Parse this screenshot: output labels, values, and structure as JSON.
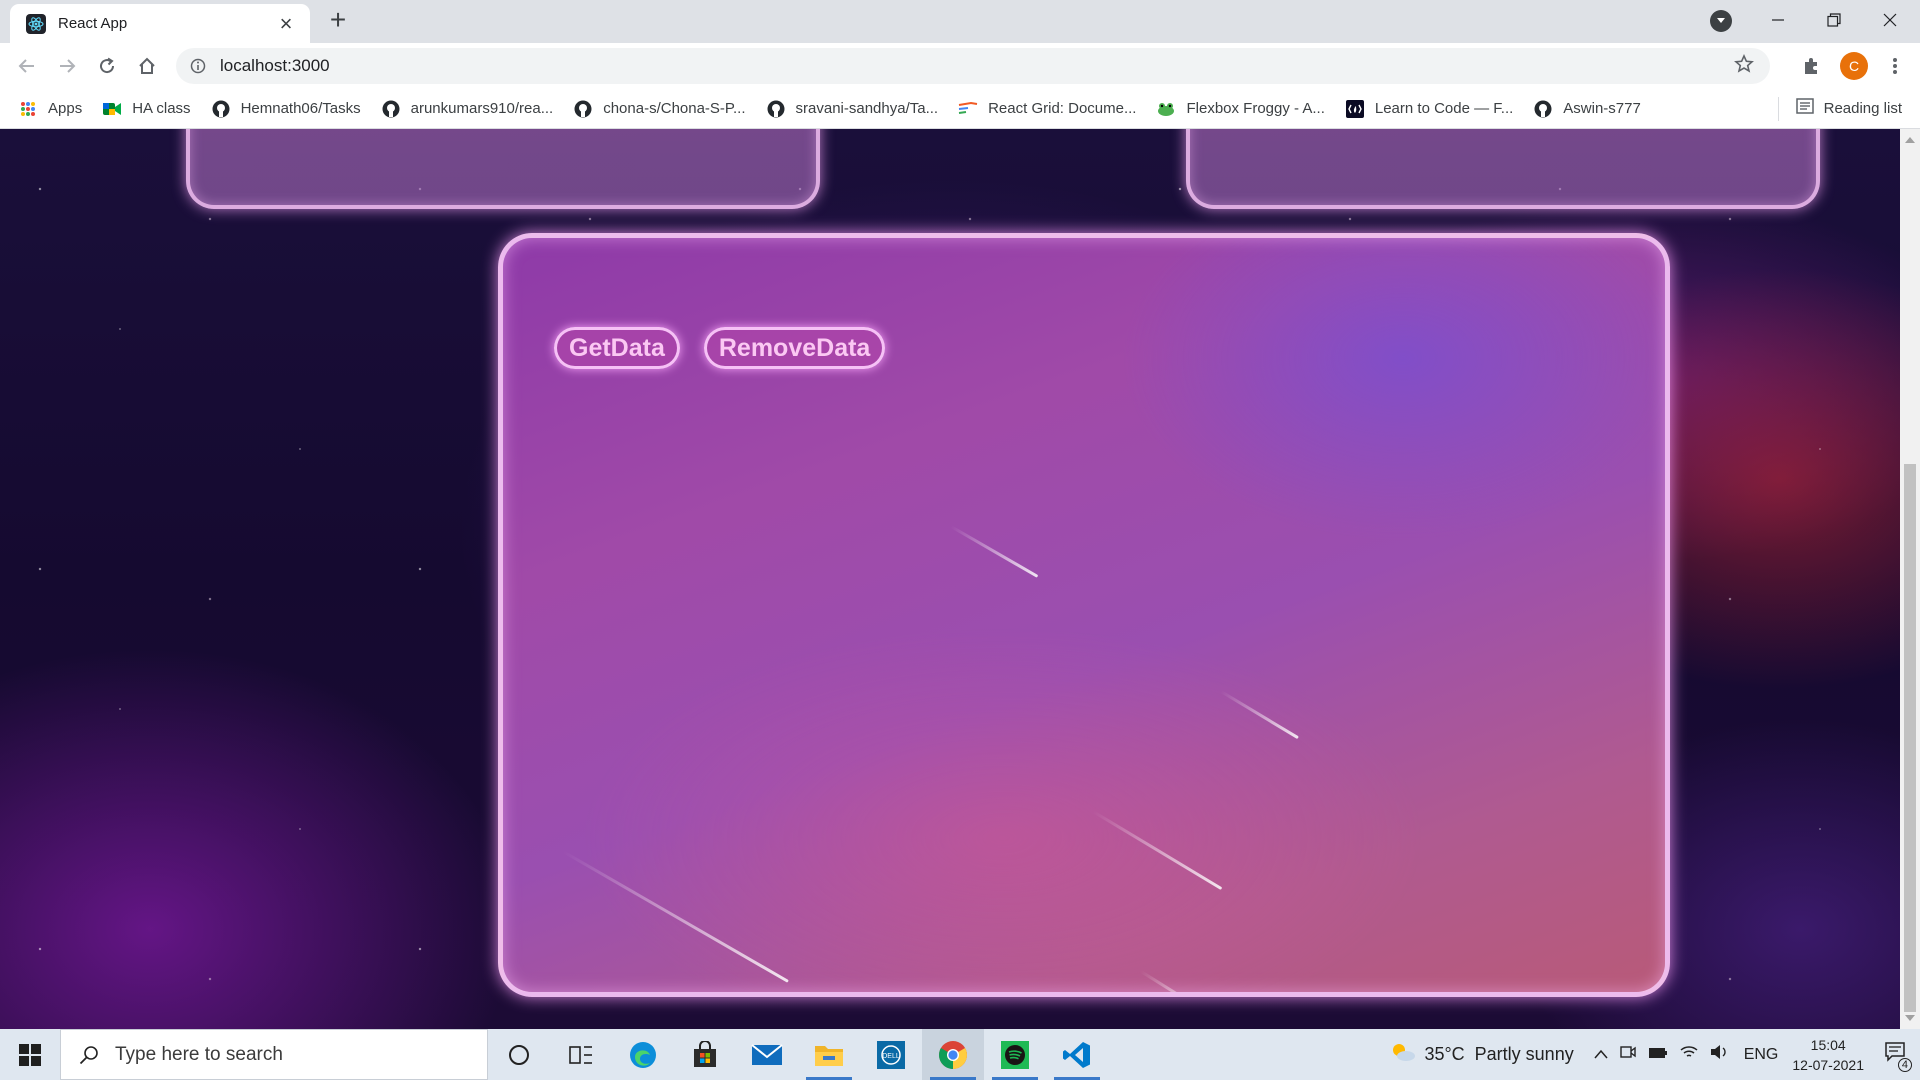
{
  "browser": {
    "tab_title": "React App",
    "url": "localhost:3000",
    "profile_initial": "C",
    "bookmarks": [
      {
        "label": "Apps",
        "icon": "apps-grid-icon"
      },
      {
        "label": "HA class",
        "icon": "google-meet-icon"
      },
      {
        "label": "Hemnath06/Tasks",
        "icon": "github-icon"
      },
      {
        "label": "arunkumars910/rea...",
        "icon": "github-icon"
      },
      {
        "label": "chona-s/Chona-S-P...",
        "icon": "github-icon"
      },
      {
        "label": "sravani-sandhya/Ta...",
        "icon": "github-icon"
      },
      {
        "label": "React Grid: Docume...",
        "icon": "react-grid-icon"
      },
      {
        "label": "Flexbox Froggy - A...",
        "icon": "frog-icon"
      },
      {
        "label": "Learn to Code — F...",
        "icon": "freecodecamp-icon"
      },
      {
        "label": "Aswin-s777",
        "icon": "github-icon"
      }
    ],
    "reading_list": "Reading list"
  },
  "page": {
    "get_data_button": "GetData",
    "remove_data_button": "RemoveData"
  },
  "taskbar": {
    "search_placeholder": "Type here to search",
    "weather_temp": "35°C",
    "weather_desc": "Partly sunny",
    "language": "ENG",
    "time": "15:04",
    "date": "12-07-2021",
    "notification_count": "4"
  },
  "colors": {
    "accent_glow": "#fbc8f3",
    "profile_avatar": "#e8710a",
    "taskbar": "#dfe7f0"
  }
}
